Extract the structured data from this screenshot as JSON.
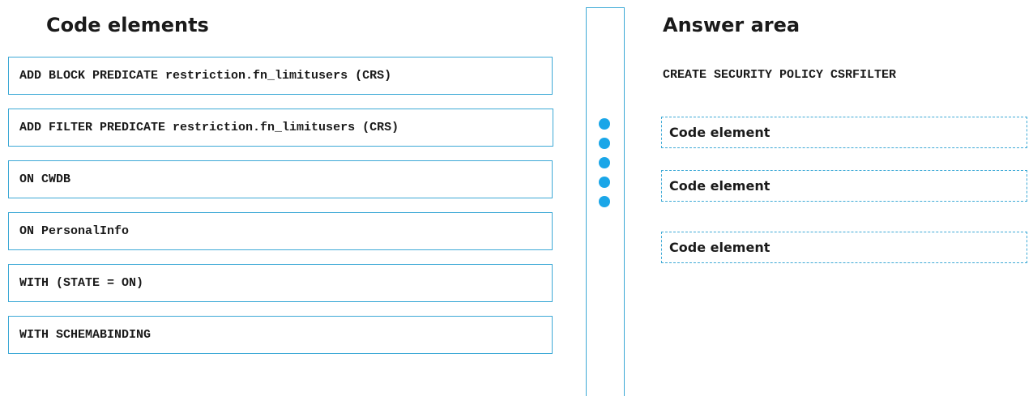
{
  "left_panel": {
    "title": "Code elements",
    "items": [
      "ADD BLOCK PREDICATE restriction.fn_limitusers (CRS)",
      "ADD FILTER PREDICATE restriction.fn_limitusers (CRS)",
      "ON CWDB",
      "ON PersonalInfo",
      "WITH (STATE = ON)",
      "WITH SCHEMABINDING"
    ]
  },
  "divider": {
    "icon": "drag-handle-dots-icon",
    "dot_color": "#1aa6e8",
    "border_color": "#3da9d6"
  },
  "answer_area": {
    "title": "Answer area",
    "statement": "CREATE SECURITY POLICY CSRFILTER",
    "slots": [
      "Code element",
      "Code element",
      "Code element"
    ]
  }
}
